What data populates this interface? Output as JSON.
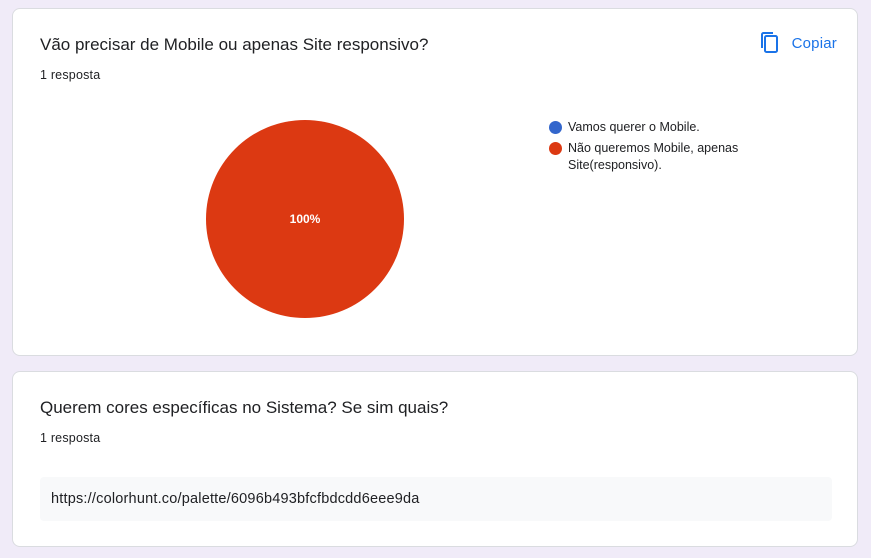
{
  "questions": [
    {
      "title": "Vão precisar de Mobile ou apenas Site responsivo?",
      "response_count": "1 resposta",
      "copy_label": "Copiar"
    },
    {
      "title": "Querem cores específicas no  Sistema? Se sim quais?",
      "response_count": "1 resposta",
      "answers": [
        "https://colorhunt.co/palette/6096b493bfcfbdcdd6eee9da"
      ]
    }
  ],
  "icons": {
    "copy": "copy-icon"
  },
  "chart_data": {
    "type": "pie",
    "slices": [
      {
        "label": "Vamos querer o Mobile.",
        "value": 0,
        "color": "#3366cc"
      },
      {
        "label": "Não queremos Mobile, apenas Site(responsivo).",
        "value": 100,
        "color": "#dc3912"
      }
    ],
    "data_labels": [
      "100%"
    ],
    "legend_position": "right"
  },
  "colors": {
    "accent": "#1a73e8",
    "background": "#f0ebf8"
  }
}
